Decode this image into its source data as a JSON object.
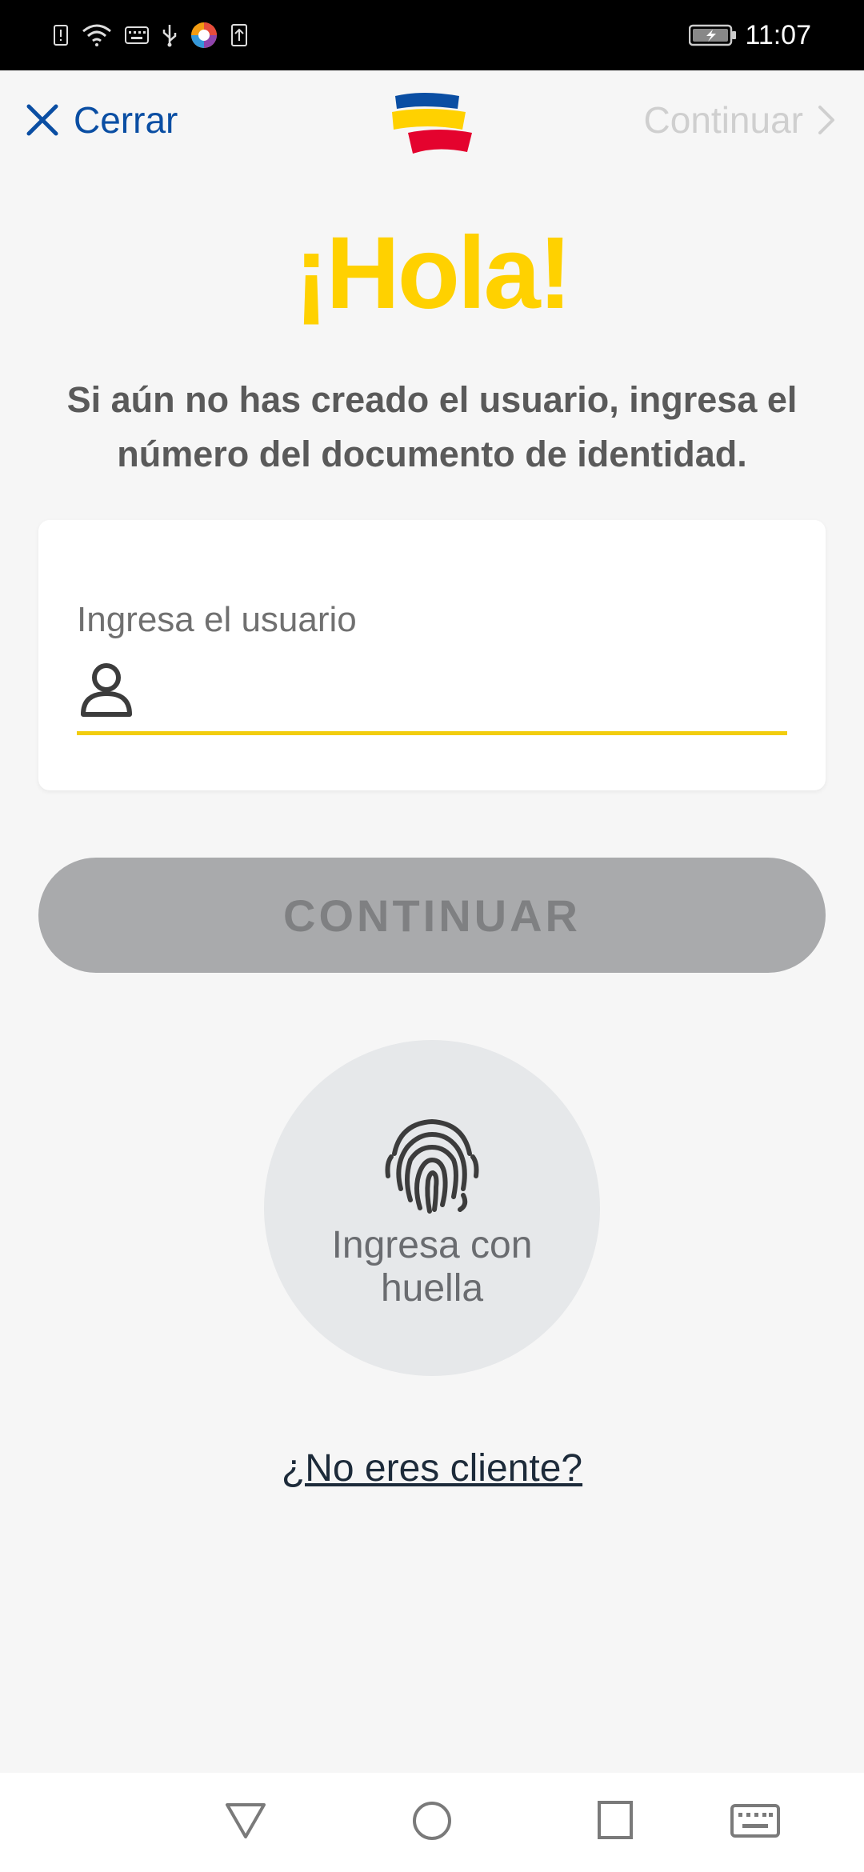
{
  "status_bar": {
    "time": "11:07",
    "left_icons": [
      "alert-icon",
      "wifi-icon",
      "keyboard-icon",
      "usb-icon",
      "app-icon",
      "upload-icon"
    ],
    "right_icons": [
      "battery-charging-icon"
    ]
  },
  "top_nav": {
    "close_label": "Cerrar",
    "continue_label": "Continuar"
  },
  "greeting": {
    "title": "¡Hola!",
    "instructions": "Si aún no has creado el usuario, ingresa el número del documento de identidad."
  },
  "user_field": {
    "label": "Ingresa el usuario",
    "value": ""
  },
  "continue_button": {
    "label": "CONTINUAR"
  },
  "fingerprint": {
    "label": "Ingresa con huella"
  },
  "not_client": {
    "label": "¿No eres cliente?"
  },
  "colors": {
    "brand_yellow": "#ffd100",
    "brand_blue": "#0a4ea3",
    "brand_red": "#e4032e",
    "disabled_button": "#a9aaac"
  },
  "navigation": {
    "icons": [
      "back-nav-icon",
      "home-nav-icon",
      "recents-nav-icon",
      "keyboard-nav-icon"
    ]
  }
}
